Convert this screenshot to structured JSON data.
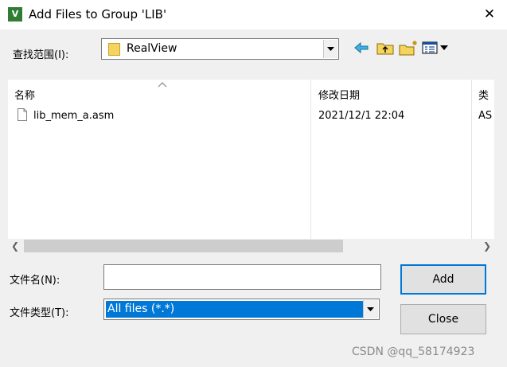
{
  "window": {
    "title": "Add Files to Group 'LIB'",
    "app_icon_text": "V"
  },
  "lookin": {
    "label": "查找范围(I):",
    "value": "RealView"
  },
  "toolbar": {
    "icons": [
      "back-arrow-icon",
      "up-folder-icon",
      "new-folder-icon",
      "view-menu-icon"
    ]
  },
  "filelist": {
    "columns": [
      "名称",
      "修改日期",
      "类"
    ],
    "rows": [
      {
        "name": "lib_mem_a.asm",
        "modified": "2021/12/1 22:04",
        "type": "AS"
      }
    ]
  },
  "filename": {
    "label": "文件名(N):",
    "value": ""
  },
  "filetype": {
    "label": "文件类型(T):",
    "value": "All files (*.*)"
  },
  "buttons": {
    "add": "Add",
    "close": "Close"
  },
  "watermark": "CSDN @qq_58174923",
  "colors": {
    "selection": "#0078d7",
    "background": "#f0f0f0",
    "folder": "#f4d35e"
  }
}
